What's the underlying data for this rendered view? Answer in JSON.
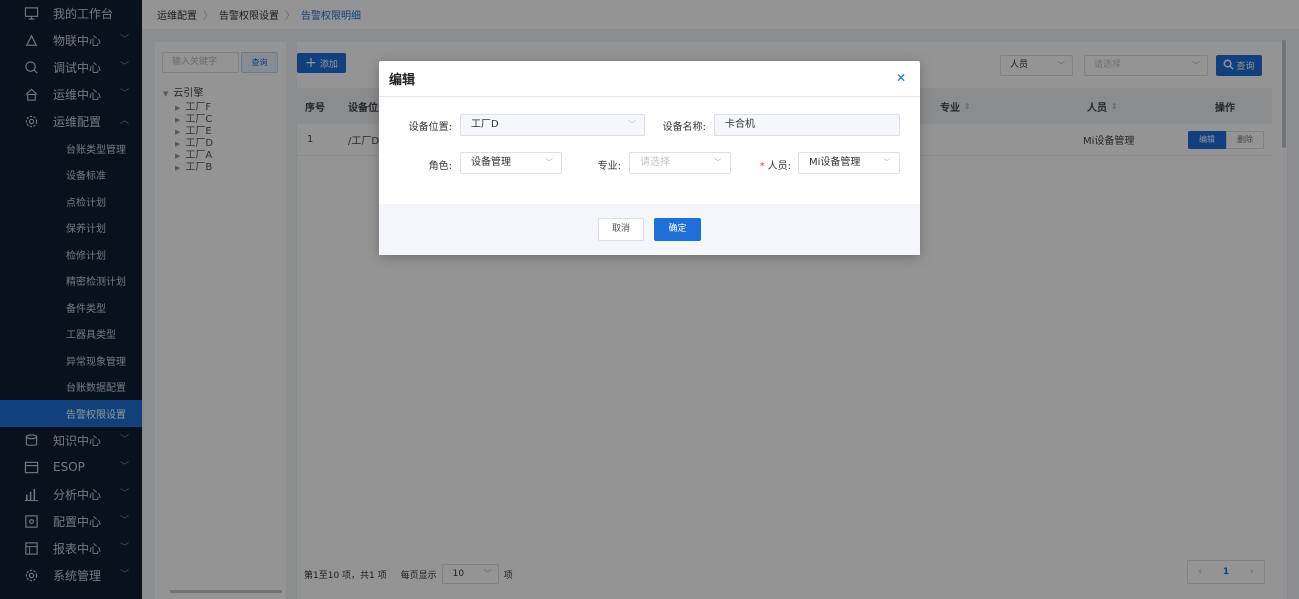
{
  "sidebar": {
    "top_items": [
      {
        "label": "我的工作台",
        "icon": "monitor-icon",
        "chevron": false
      },
      {
        "label": "物联中心",
        "icon": "iot-icon",
        "chevron": true
      },
      {
        "label": "调试中心",
        "icon": "debug-icon",
        "chevron": true
      },
      {
        "label": "运维中心",
        "icon": "home-icon",
        "chevron": true
      },
      {
        "label": "运维配置",
        "icon": "gear-icon",
        "chevron": true
      }
    ],
    "sub_items": [
      "台账类型管理",
      "设备标准",
      "点检计划",
      "保养计划",
      "检修计划",
      "精密检测计划",
      "备件类型",
      "工器具类型",
      "异常现象管理",
      "台账数据配置",
      "告警权限设置"
    ],
    "bottom_items": [
      {
        "label": "知识中心",
        "icon": "database-icon"
      },
      {
        "label": "ESOP",
        "icon": "esop-icon"
      },
      {
        "label": "分析中心",
        "icon": "chart-icon"
      },
      {
        "label": "配置中心",
        "icon": "config-icon"
      },
      {
        "label": "报表中心",
        "icon": "report-icon"
      },
      {
        "label": "系统管理",
        "icon": "settings-icon"
      }
    ]
  },
  "breadcrumb": [
    "运维配置",
    "告警权限设置",
    "告警权限明细"
  ],
  "tree": {
    "search_placeholder": "输入关键字",
    "search_button": "查询",
    "root": "云引擎",
    "nodes": [
      "工厂F",
      "工厂C",
      "工厂E",
      "工厂D",
      "工厂A",
      "工厂B"
    ]
  },
  "toolbar": {
    "add_label": "添加",
    "person_filter": "人员",
    "select_placeholder": "请选择",
    "query_label": "查询"
  },
  "table": {
    "headers": {
      "index": "序号",
      "location": "设备位置",
      "specialty": "专业",
      "person": "人员",
      "operation": "操作"
    },
    "rows": [
      {
        "index": "1",
        "location": "/工厂D",
        "person": "Mi设备管理",
        "edit": "编辑",
        "delete": "删除"
      }
    ]
  },
  "pagination": {
    "info": "第1至10 项，共1 项",
    "per_page_label": "每页显示",
    "per_page_value": "10",
    "unit": "项",
    "prev": "‹",
    "current_page": "1",
    "next": "›"
  },
  "modal": {
    "title": "编辑",
    "fields": {
      "location_label": "设备位置:",
      "location_value": "工厂D",
      "name_label": "设备名称:",
      "name_value": "卡合机",
      "role_label": "角色:",
      "role_value": "设备管理",
      "specialty_label": "专业:",
      "specialty_placeholder": "请选择",
      "person_required": "*",
      "person_label": "人员:",
      "person_value": "Mi设备管理"
    },
    "cancel_label": "取消",
    "ok_label": "确定"
  },
  "colors": {
    "primary": "#1e6fd9",
    "sidebar_bg": "#0f1f33",
    "required": "#e64242"
  }
}
